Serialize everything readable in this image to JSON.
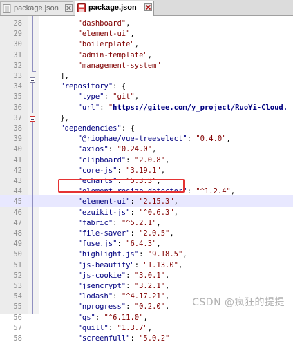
{
  "tabs": [
    {
      "label": "package.json",
      "active": false,
      "close_glyph": "✖"
    },
    {
      "label": "package.json",
      "active": true,
      "close_glyph": "✖"
    }
  ],
  "editor": {
    "current_line": 45,
    "lines": [
      {
        "n": "28",
        "parts": [
          [
            "        ",
            "p"
          ],
          [
            "\"dashboard\"",
            "str"
          ],
          [
            ",",
            "p"
          ]
        ]
      },
      {
        "n": "29",
        "parts": [
          [
            "        ",
            "p"
          ],
          [
            "\"element-ui\"",
            "str"
          ],
          [
            ",",
            "p"
          ]
        ]
      },
      {
        "n": "30",
        "parts": [
          [
            "        ",
            "p"
          ],
          [
            "\"boilerplate\"",
            "str"
          ],
          [
            ",",
            "p"
          ]
        ]
      },
      {
        "n": "31",
        "parts": [
          [
            "        ",
            "p"
          ],
          [
            "\"admin-template\"",
            "str"
          ],
          [
            ",",
            "p"
          ]
        ]
      },
      {
        "n": "32",
        "parts": [
          [
            "        ",
            "p"
          ],
          [
            "\"management-system\"",
            "str"
          ]
        ]
      },
      {
        "n": "33",
        "parts": [
          [
            "    ",
            "p"
          ],
          [
            "],",
            "p"
          ]
        ]
      },
      {
        "n": "34",
        "parts": [
          [
            "    ",
            "p"
          ],
          [
            "\"repository\"",
            "key"
          ],
          [
            ": {",
            "p"
          ]
        ]
      },
      {
        "n": "35",
        "parts": [
          [
            "        ",
            "p"
          ],
          [
            "\"type\"",
            "key"
          ],
          [
            ": ",
            "p"
          ],
          [
            "\"git\"",
            "str"
          ],
          [
            ",",
            "p"
          ]
        ]
      },
      {
        "n": "36",
        "parts": [
          [
            "        ",
            "p"
          ],
          [
            "\"url\"",
            "key"
          ],
          [
            ": ",
            "p"
          ],
          [
            "\"",
            "str"
          ],
          [
            "https://gitee.com/y_project/RuoYi-Cloud.",
            "url"
          ]
        ]
      },
      {
        "n": "37",
        "parts": [
          [
            "    ",
            "p"
          ],
          [
            "},",
            "p"
          ]
        ]
      },
      {
        "n": "38",
        "parts": [
          [
            "    ",
            "p"
          ],
          [
            "\"dependencies\"",
            "key"
          ],
          [
            ": {",
            "p"
          ]
        ]
      },
      {
        "n": "39",
        "parts": [
          [
            "        ",
            "p"
          ],
          [
            "\"@riophae/vue-treeselect\"",
            "key"
          ],
          [
            ": ",
            "p"
          ],
          [
            "\"0.4.0\"",
            "str"
          ],
          [
            ",",
            "p"
          ]
        ]
      },
      {
        "n": "40",
        "parts": [
          [
            "        ",
            "p"
          ],
          [
            "\"axios\"",
            "key"
          ],
          [
            ": ",
            "p"
          ],
          [
            "\"0.24.0\"",
            "str"
          ],
          [
            ",",
            "p"
          ]
        ]
      },
      {
        "n": "41",
        "parts": [
          [
            "        ",
            "p"
          ],
          [
            "\"clipboard\"",
            "key"
          ],
          [
            ": ",
            "p"
          ],
          [
            "\"2.0.8\"",
            "str"
          ],
          [
            ",",
            "p"
          ]
        ]
      },
      {
        "n": "42",
        "parts": [
          [
            "        ",
            "p"
          ],
          [
            "\"core-js\"",
            "key"
          ],
          [
            ": ",
            "p"
          ],
          [
            "\"3.19.1\"",
            "str"
          ],
          [
            ",",
            "p"
          ]
        ]
      },
      {
        "n": "43",
        "parts": [
          [
            "        ",
            "p"
          ],
          [
            "\"echarts\"",
            "key"
          ],
          [
            ": ",
            "p"
          ],
          [
            "\"5.3.3\"",
            "str"
          ],
          [
            ",",
            "p"
          ]
        ]
      },
      {
        "n": "44",
        "parts": [
          [
            "        ",
            "p"
          ],
          [
            "\"element-resize-detector\"",
            "key"
          ],
          [
            ": ",
            "p"
          ],
          [
            "\"^1.2.4\"",
            "str"
          ],
          [
            ",",
            "p"
          ]
        ]
      },
      {
        "n": "45",
        "parts": [
          [
            "        ",
            "p"
          ],
          [
            "\"element-ui\"",
            "key"
          ],
          [
            ": ",
            "p"
          ],
          [
            "\"2.15.3\"",
            "str"
          ],
          [
            ",",
            "p"
          ]
        ]
      },
      {
        "n": "46",
        "parts": [
          [
            "        ",
            "p"
          ],
          [
            "\"ezuikit-js\"",
            "key"
          ],
          [
            ": ",
            "p"
          ],
          [
            "\"^0.6.3\"",
            "str"
          ],
          [
            ",",
            "p"
          ]
        ]
      },
      {
        "n": "47",
        "parts": [
          [
            "        ",
            "p"
          ],
          [
            "\"fabric\"",
            "key"
          ],
          [
            ": ",
            "p"
          ],
          [
            "\"^5.2.1\"",
            "str"
          ],
          [
            ",",
            "p"
          ]
        ]
      },
      {
        "n": "48",
        "parts": [
          [
            "        ",
            "p"
          ],
          [
            "\"file-saver\"",
            "key"
          ],
          [
            ": ",
            "p"
          ],
          [
            "\"2.0.5\"",
            "str"
          ],
          [
            ",",
            "p"
          ]
        ]
      },
      {
        "n": "49",
        "parts": [
          [
            "        ",
            "p"
          ],
          [
            "\"fuse.js\"",
            "key"
          ],
          [
            ": ",
            "p"
          ],
          [
            "\"6.4.3\"",
            "str"
          ],
          [
            ",",
            "p"
          ]
        ]
      },
      {
        "n": "50",
        "parts": [
          [
            "        ",
            "p"
          ],
          [
            "\"highlight.js\"",
            "key"
          ],
          [
            ": ",
            "p"
          ],
          [
            "\"9.18.5\"",
            "str"
          ],
          [
            ",",
            "p"
          ]
        ]
      },
      {
        "n": "51",
        "parts": [
          [
            "        ",
            "p"
          ],
          [
            "\"js-beautify\"",
            "key"
          ],
          [
            ": ",
            "p"
          ],
          [
            "\"1.13.0\"",
            "str"
          ],
          [
            ",",
            "p"
          ]
        ]
      },
      {
        "n": "52",
        "parts": [
          [
            "        ",
            "p"
          ],
          [
            "\"js-cookie\"",
            "key"
          ],
          [
            ": ",
            "p"
          ],
          [
            "\"3.0.1\"",
            "str"
          ],
          [
            ",",
            "p"
          ]
        ]
      },
      {
        "n": "53",
        "parts": [
          [
            "        ",
            "p"
          ],
          [
            "\"jsencrypt\"",
            "key"
          ],
          [
            ": ",
            "p"
          ],
          [
            "\"3.2.1\"",
            "str"
          ],
          [
            ",",
            "p"
          ]
        ]
      },
      {
        "n": "54",
        "parts": [
          [
            "        ",
            "p"
          ],
          [
            "\"lodash\"",
            "key"
          ],
          [
            ": ",
            "p"
          ],
          [
            "\"^4.17.21\"",
            "str"
          ],
          [
            ",",
            "p"
          ]
        ]
      },
      {
        "n": "55",
        "parts": [
          [
            "        ",
            "p"
          ],
          [
            "\"nprogress\"",
            "key"
          ],
          [
            ": ",
            "p"
          ],
          [
            "\"0.2.0\"",
            "str"
          ],
          [
            ",",
            "p"
          ]
        ]
      },
      {
        "n": "56",
        "parts": [
          [
            "        ",
            "p"
          ],
          [
            "\"qs\"",
            "key"
          ],
          [
            ": ",
            "p"
          ],
          [
            "\"^6.11.0\"",
            "str"
          ],
          [
            ",",
            "p"
          ]
        ]
      },
      {
        "n": "57",
        "parts": [
          [
            "        ",
            "p"
          ],
          [
            "\"quill\"",
            "key"
          ],
          [
            ": ",
            "p"
          ],
          [
            "\"1.3.7\"",
            "str"
          ],
          [
            ",",
            "p"
          ]
        ]
      },
      {
        "n": "58",
        "parts": [
          [
            "        ",
            "p"
          ],
          [
            "\"screenfull\"",
            "key"
          ],
          [
            ": ",
            "p"
          ],
          [
            "\"5.0.2\"",
            "str"
          ]
        ]
      }
    ]
  },
  "watermark": "CSDN @疯狂的提提",
  "colors": {
    "string": "#800000",
    "key": "#000080",
    "highlight_box": "#e53333",
    "current_line": "#e8e8ff"
  }
}
